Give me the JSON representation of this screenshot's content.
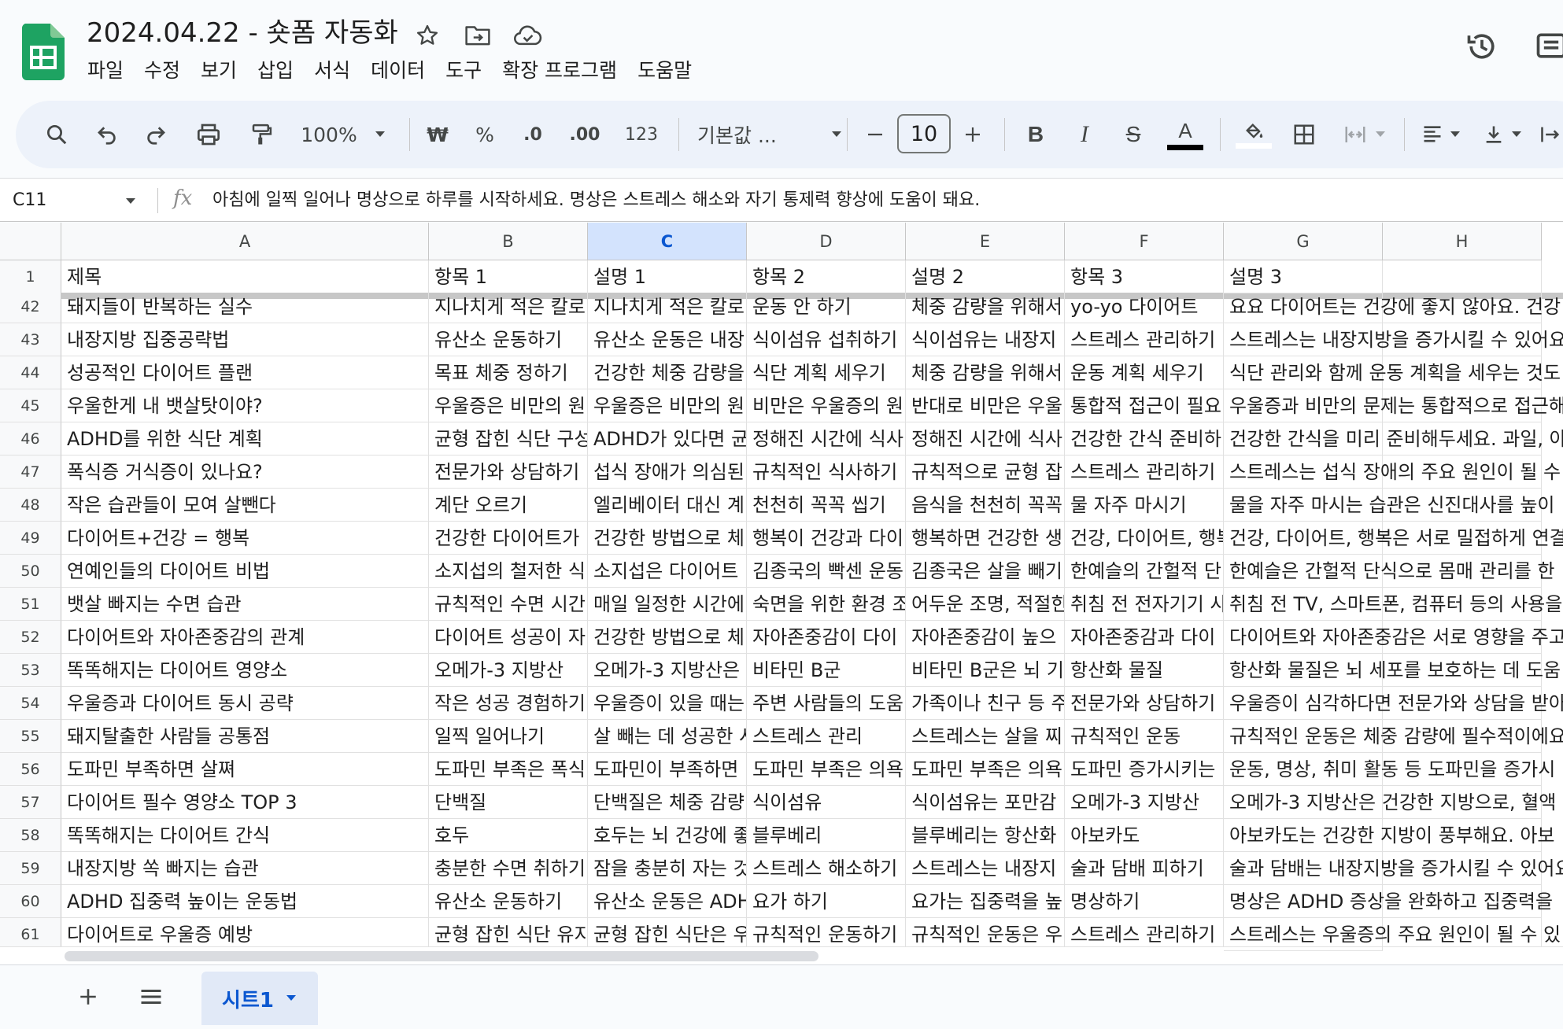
{
  "document": {
    "title": "2024.04.22 - 숏폼 자동화"
  },
  "menu": [
    "파일",
    "수정",
    "보기",
    "삽입",
    "서식",
    "데이터",
    "도구",
    "확장 프로그램",
    "도움말"
  ],
  "toolbar": {
    "zoom": "100%",
    "currency": "₩",
    "percent": "%",
    "decrease_decimal": ".0",
    "increase_decimal": ".00",
    "number_format": "123",
    "font": "기본값 ...",
    "font_size": "10",
    "text_color": "#000000"
  },
  "formula_bar": {
    "cell_ref": "C11",
    "value": "아침에 일찍 일어나 명상으로 하루를 시작하세요. 명상은 스트레스 해소와 자기 통제력 향상에 도움이 돼요."
  },
  "columns": [
    "A",
    "B",
    "C",
    "D",
    "E",
    "F",
    "G",
    "H"
  ],
  "selected_column": "C",
  "header_row": {
    "num": "1",
    "cells": [
      "제목",
      "항목 1",
      "설명 1",
      "항목 2",
      "설명 2",
      "항목 3",
      "설명 3",
      ""
    ]
  },
  "rows": [
    {
      "num": "42",
      "cells": [
        "돼지들이 반복하는 실수",
        "지나치게 적은 칼로",
        "지나치게 적은 칼로",
        "운동 안 하기",
        "체중 감량을 위해서",
        "yo-yo 다이어트",
        "요요 다이어트는 건강에 좋지 않아요. 건강",
        ""
      ]
    },
    {
      "num": "43",
      "cells": [
        "내장지방 집중공략법",
        "유산소 운동하기",
        "유산소 운동은 내장",
        "식이섬유 섭취하기",
        "식이섬유는 내장지",
        "스트레스 관리하기",
        "스트레스는 내장지방을 증가시킬 수 있어요",
        ""
      ]
    },
    {
      "num": "44",
      "cells": [
        "성공적인 다이어트 플랜",
        "목표 체중 정하기",
        "건강한 체중 감량을",
        "식단 계획 세우기",
        "체중 감량을 위해서",
        "운동 계획 세우기",
        "식단 관리와 함께 운동 계획을 세우는 것도",
        ""
      ]
    },
    {
      "num": "45",
      "cells": [
        "우울한게 내 뱃살탓이야?",
        "우울증은 비만의 원",
        "우울증은 비만의 원",
        "비만은 우울증의 원",
        "반대로 비만은 우울",
        "통합적 접근이 필요",
        "우울증과 비만의 문제는 통합적으로 접근해",
        ""
      ]
    },
    {
      "num": "46",
      "cells": [
        "ADHD를 위한 식단 계획",
        "균형 잡힌 식단 구성",
        "ADHD가 있다면 균",
        "정해진 시간에 식사",
        "정해진 시간에 식사",
        "건강한 간식 준비하",
        "건강한 간식을 미리 준비해두세요. 과일, 야",
        ""
      ]
    },
    {
      "num": "47",
      "cells": [
        "폭식증 거식증이 있나요?",
        "전문가와 상담하기",
        "섭식 장애가 의심된",
        "규칙적인 식사하기",
        "규칙적으로 균형 잡",
        "스트레스 관리하기",
        "스트레스는 섭식 장애의 주요 원인이 될 수",
        ""
      ]
    },
    {
      "num": "48",
      "cells": [
        "작은 습관들이 모여 살뺀다",
        "계단 오르기",
        "엘리베이터 대신 계",
        "천천히 꼭꼭 씹기",
        "음식을 천천히 꼭꼭",
        "물 자주 마시기",
        "물을 자주 마시는 습관은 신진대사를 높이",
        ""
      ]
    },
    {
      "num": "49",
      "cells": [
        "다이어트+건강 = 행복",
        "건강한 다이어트가",
        "건강한 방법으로 체",
        "행복이 건강과 다이",
        "행복하면 건강한 생",
        "건강, 다이어트, 행복",
        "건강, 다이어트, 행복은 서로 밀접하게 연결",
        ""
      ]
    },
    {
      "num": "50",
      "cells": [
        "연예인들의 다이어트 비법",
        "소지섭의 철저한 식",
        "소지섭은 다이어트",
        "김종국의 빡센 운동",
        "김종국은 살을 빼기",
        "한예슬의 간헐적 단",
        "한예슬은 간헐적 단식으로 몸매 관리를 한",
        ""
      ]
    },
    {
      "num": "51",
      "cells": [
        "뱃살 빠지는 수면 습관",
        "규칙적인 수면 시간",
        "매일 일정한 시간에",
        "숙면을 위한 환경 조",
        "어두운 조명, 적절한",
        "취침 전 전자기기 사",
        "취침 전 TV, 스마트폰, 컴퓨터 등의 사용을",
        ""
      ]
    },
    {
      "num": "52",
      "cells": [
        "다이어트와 자아존중감의 관계",
        "다이어트 성공이 자",
        "건강한 방법으로 체",
        "자아존중감이 다이",
        "자아존중감이 높으",
        "자아존중감과 다이",
        "다이어트와 자아존중감은 서로 영향을 주고",
        ""
      ]
    },
    {
      "num": "53",
      "cells": [
        "똑똑해지는 다이어트 영양소",
        "오메가-3 지방산",
        "오메가-3 지방산은",
        "비타민 B군",
        "비타민 B군은 뇌 기",
        "항산화 물질",
        "항산화 물질은 뇌 세포를 보호하는 데 도움",
        ""
      ]
    },
    {
      "num": "54",
      "cells": [
        "우울증과 다이어트 동시 공략",
        "작은 성공 경험하기",
        "우울증이 있을 때는",
        "주변 사람들의 도움",
        "가족이나 친구 등 주",
        "전문가와 상담하기",
        "우울증이 심각하다면 전문가와 상담을 받아",
        ""
      ]
    },
    {
      "num": "55",
      "cells": [
        "돼지탈출한 사람들 공통점",
        "일찍 일어나기",
        "살 빼는 데 성공한 사",
        "스트레스 관리",
        "스트레스는 살을 찌",
        "규칙적인 운동",
        "규칙적인 운동은 체중 감량에 필수적이에요",
        ""
      ]
    },
    {
      "num": "56",
      "cells": [
        "도파민 부족하면 살쪄",
        "도파민 부족은 폭식",
        "도파민이 부족하면",
        "도파민 부족은 의욕",
        "도파민 부족은 의욕",
        "도파민 증가시키는",
        "운동, 명상, 취미 활동 등 도파민을 증가시",
        ""
      ]
    },
    {
      "num": "57",
      "cells": [
        "다이어트 필수 영양소 TOP 3",
        "단백질",
        "단백질은 체중 감량",
        "식이섬유",
        "식이섬유는 포만감",
        "오메가-3 지방산",
        "오메가-3 지방산은 건강한 지방으로, 혈액",
        ""
      ]
    },
    {
      "num": "58",
      "cells": [
        "똑똑해지는 다이어트 간식",
        "호두",
        "호두는 뇌 건강에 좋",
        "블루베리",
        "블루베리는 항산화",
        "아보카도",
        "아보카도는 건강한 지방이 풍부해요. 아보",
        ""
      ]
    },
    {
      "num": "59",
      "cells": [
        "내장지방 쏙 빠지는 습관",
        "충분한 수면 취하기",
        "잠을 충분히 자는 것",
        "스트레스 해소하기",
        "스트레스는 내장지",
        "술과 담배 피하기",
        "술과 담배는 내장지방을 증가시킬 수 있어요",
        ""
      ]
    },
    {
      "num": "60",
      "cells": [
        "ADHD 집중력 높이는 운동법",
        "유산소 운동하기",
        "유산소 운동은 ADH",
        "요가 하기",
        "요가는 집중력을 높",
        "명상하기",
        "명상은 ADHD 증상을 완화하고 집중력을",
        ""
      ]
    },
    {
      "num": "61",
      "cells": [
        "다이어트로 우울증 예방",
        "균형 잡힌 식단 유지",
        "균형 잡힌 식단은 우",
        "규칙적인 운동하기",
        "규칙적인 운동은 우",
        "스트레스 관리하기",
        "스트레스는 우울증의 주요 원인이 될 수 있",
        ""
      ]
    }
  ],
  "sheet_tab": {
    "label": "시트1"
  },
  "colors": {
    "accent": "#0b57d0",
    "sheets_green": "#188038",
    "selected_header": "#d3e3fd"
  }
}
